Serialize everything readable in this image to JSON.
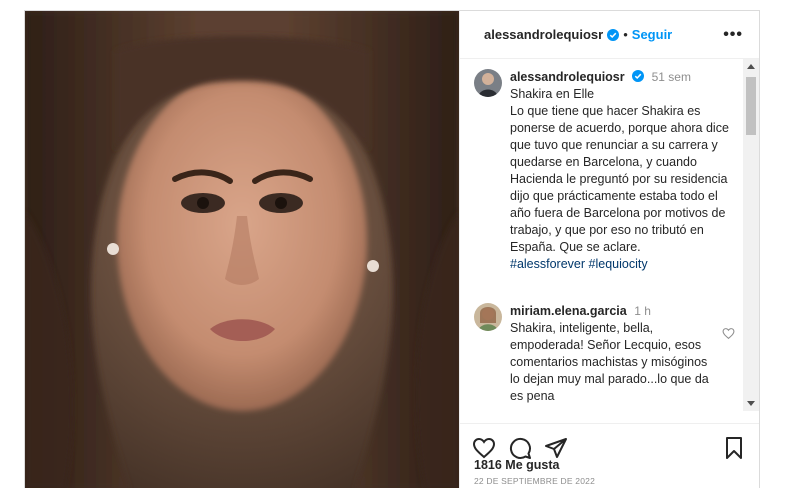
{
  "header": {
    "username": "alessandrolequiosr",
    "separator": "•",
    "follow_label": "Seguir",
    "more_label": "•••",
    "verified_color": "#0095f6"
  },
  "caption": {
    "username": "alessandrolequiosr",
    "time": "51 sem",
    "text": "Shakira en Elle\nLo que tiene que hacer Shakira es ponerse de acuerdo, porque ahora dice que tuvo que renunciar a su carrera y quedarse en Barcelona, y cuando Hacienda le preguntó por su residencia dijo que prácticamente estaba todo el año fuera de Barcelona por motivos de trabajo, y que por eso no tributó en España. Que se aclare.",
    "hashtags": "#alessforever #lequiocity"
  },
  "comments": [
    {
      "username": "miriam.elena.garcia",
      "time": "1 h",
      "text": "Shakira, inteligente, bella, empoderada! Señor Lecquio, esos comentarios machistas y misóginos lo dejan muy mal parado...lo que da es pena"
    }
  ],
  "actions": {
    "like_icon": "heart-icon",
    "comment_icon": "comment-icon",
    "share_icon": "share-icon",
    "save_icon": "bookmark-icon"
  },
  "likes_text": "1816 Me gusta",
  "date_text": "22 DE SEPTIEMBRE DE 2022",
  "colors": {
    "link": "#0095f6",
    "hashtag": "#00376b",
    "muted": "#8e8e8e",
    "text": "#262626"
  }
}
